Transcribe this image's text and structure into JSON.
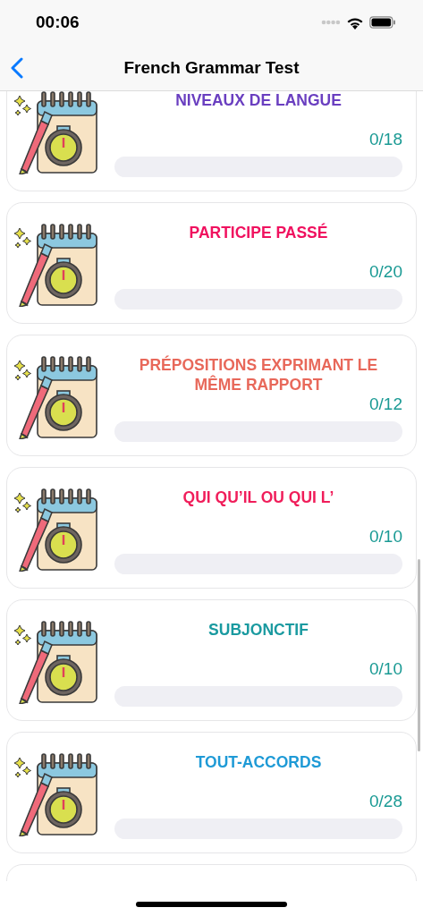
{
  "status_bar": {
    "time": "00:06"
  },
  "nav": {
    "title": "French Grammar Test"
  },
  "tests": [
    {
      "title": "NIVEAUX DE LANGUE",
      "color": "#6a3fc0",
      "count": "0/18",
      "level": 0
    },
    {
      "title": "PARTICIPE PASSÉ",
      "color": "#f0115f",
      "count": "0/20",
      "level": 0
    },
    {
      "title": "PRÉPOSITIONS EXPRIMANT LE MÊME RAPPORT",
      "color": "#e8685a",
      "count": "0/12",
      "level": 0
    },
    {
      "title": "QUI QU’IL OU QUI L’",
      "color": "#f01d5a",
      "count": "0/10",
      "level": 0
    },
    {
      "title": "SUBJONCTIF",
      "color": "#1a9aa0",
      "count": "0/10",
      "level": 0
    },
    {
      "title": "TOUT-ACCORDS",
      "color": "#1e9ad6",
      "count": "0/28",
      "level": 0
    }
  ]
}
